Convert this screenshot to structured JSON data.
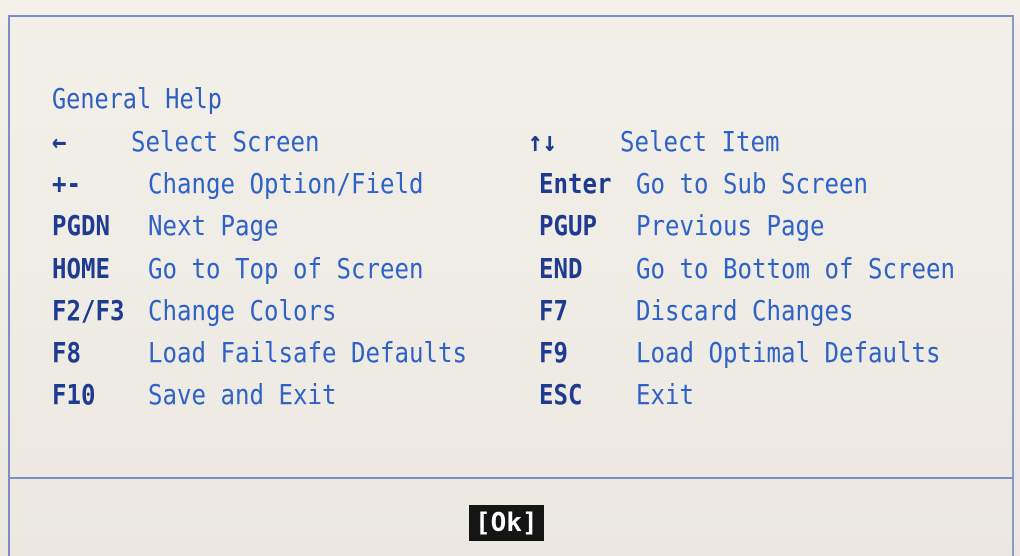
{
  "dialog": {
    "title": "General Help",
    "rows": [
      {
        "left_key": "←",
        "left_desc": "Select Screen",
        "right_key": "↑↓",
        "right_desc": "Select Item"
      },
      {
        "left_key": "+-",
        "left_desc": "Change Option/Field",
        "right_key": "Enter",
        "right_desc": "Go to Sub Screen"
      },
      {
        "left_key": "PGDN",
        "left_desc": "Next Page",
        "right_key": "PGUP",
        "right_desc": "Previous Page"
      },
      {
        "left_key": "HOME",
        "left_desc": "Go to Top of Screen",
        "right_key": "END",
        "right_desc": "Go to Bottom of Screen"
      },
      {
        "left_key": "F2/F3",
        "left_desc": "Change Colors",
        "right_key": "F7",
        "right_desc": "Discard Changes"
      },
      {
        "left_key": "F8",
        "left_desc": "Load Failsafe Defaults",
        "right_key": "F9",
        "right_desc": "Load Optimal Defaults"
      },
      {
        "left_key": "F10",
        "left_desc": "Save and Exit",
        "right_key": "ESC",
        "right_desc": "Exit"
      }
    ],
    "ok_label": "[Ok]"
  },
  "colors": {
    "background": "#f2eee8",
    "text_blue": "#2e62c7",
    "key_blue": "#1f3b8f",
    "border": "#7c8fc2",
    "button_bg": "#151515",
    "button_text": "#ffffff"
  }
}
